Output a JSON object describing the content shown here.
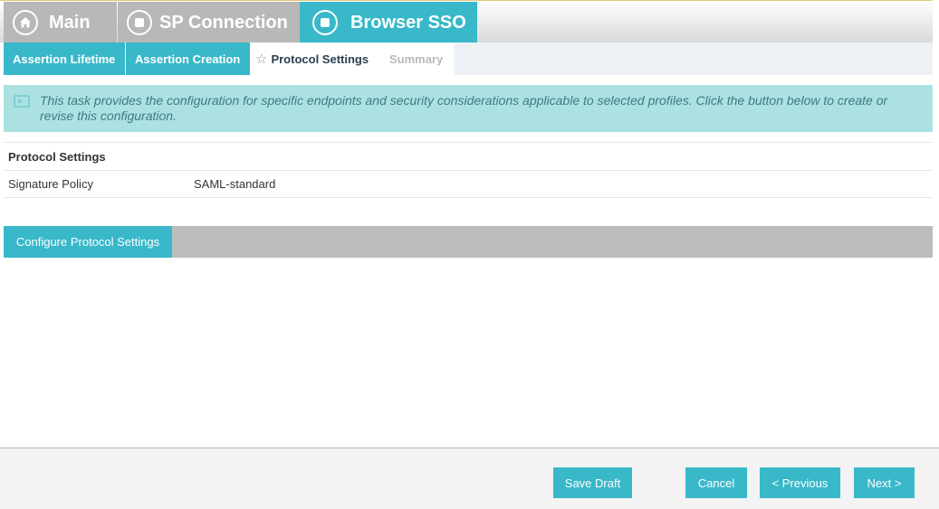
{
  "breadcrumbs": [
    {
      "label": "Main",
      "icon": "home-icon",
      "state": "inactive"
    },
    {
      "label": "SP Connection",
      "icon": "stop-icon",
      "state": "inactive"
    },
    {
      "label": "Browser SSO",
      "icon": "stop-icon",
      "state": "active"
    }
  ],
  "subtabs": {
    "assertion_lifetime": "Assertion Lifetime",
    "assertion_creation": "Assertion Creation",
    "protocol_settings": "Protocol Settings",
    "summary": "Summary"
  },
  "banner": {
    "text": "This task provides the configuration for specific endpoints and security considerations applicable to selected profiles. Click the button below to create or revise this configuration."
  },
  "settings": {
    "heading": "Protocol Settings",
    "rows": [
      {
        "label": "Signature Policy",
        "value": "SAML-standard"
      }
    ]
  },
  "configure_button": "Configure Protocol Settings",
  "footer": {
    "save_draft": "Save Draft",
    "cancel": "Cancel",
    "previous": "< Previous",
    "next": "Next >"
  },
  "colors": {
    "accent": "#38b8c9",
    "inactive_tab": "#b8b8b8",
    "banner_bg": "#abe2e1"
  }
}
